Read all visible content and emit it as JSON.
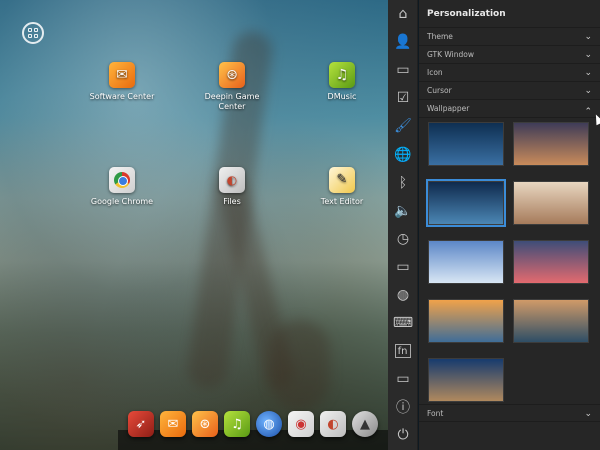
{
  "desktop": {
    "icons": [
      {
        "label": "Software Center",
        "glyph": "✉"
      },
      {
        "label": "Deepin Game Center",
        "glyph": "⊛"
      },
      {
        "label": "DMusic",
        "glyph": "♫"
      },
      {
        "label": "Google Chrome",
        "glyph": ""
      },
      {
        "label": "Files",
        "glyph": "◐"
      },
      {
        "label": "Text Editor",
        "glyph": "✎"
      }
    ]
  },
  "dock": {
    "items": [
      {
        "name": "rocket-launcher",
        "glyph": "➶"
      },
      {
        "name": "software-center",
        "glyph": "✉"
      },
      {
        "name": "game-center",
        "glyph": "⊛"
      },
      {
        "name": "dmusic",
        "glyph": "♫"
      },
      {
        "name": "browser",
        "glyph": "◍"
      },
      {
        "name": "chrome",
        "glyph": "◉"
      },
      {
        "name": "files",
        "glyph": "◐"
      },
      {
        "name": "settings",
        "glyph": "▲"
      },
      {
        "name": "more",
        "glyph": "⚙"
      }
    ]
  },
  "sidebar": {
    "items": [
      {
        "icon": "home-icon",
        "glyph": "⌂"
      },
      {
        "icon": "account-icon",
        "glyph": "👤"
      },
      {
        "icon": "display-icon",
        "glyph": "▭"
      },
      {
        "icon": "default-apps-icon",
        "glyph": "☑"
      },
      {
        "icon": "personalization-icon",
        "glyph": "🖌"
      },
      {
        "icon": "network-icon",
        "glyph": "🌐"
      },
      {
        "icon": "bluetooth-icon",
        "glyph": "ᛒ"
      },
      {
        "icon": "sound-icon",
        "glyph": "🔈"
      },
      {
        "icon": "time-icon",
        "glyph": "◷"
      },
      {
        "icon": "power-icon",
        "glyph": "▭"
      },
      {
        "icon": "mouse-icon",
        "glyph": "◍"
      },
      {
        "icon": "keyboard-icon",
        "glyph": "⌨"
      },
      {
        "icon": "font-icon",
        "glyph": "fn"
      },
      {
        "icon": "system-info-icon",
        "glyph": "▭"
      },
      {
        "icon": "info-icon",
        "glyph": "ⓘ"
      },
      {
        "icon": "shutdown-icon",
        "glyph": "⏻"
      }
    ]
  },
  "panel": {
    "title": "Personalization",
    "sections": {
      "theme": "Theme",
      "gtk": "GTK Window",
      "icon": "Icon",
      "cursor": "Cursor",
      "wallpaper": "Wallpapper",
      "font": "Font"
    },
    "chevron_down": "⌄",
    "chevron_up": "⌃"
  },
  "wallpapers": [
    {
      "name": "starry-blue",
      "selected": false,
      "c1": "#0e2f52",
      "c2": "#3a6fa2"
    },
    {
      "name": "sunset-hills",
      "selected": false,
      "c1": "#3f3c58",
      "c2": "#c98b5a"
    },
    {
      "name": "tree-night",
      "selected": true,
      "c1": "#0f2a4d",
      "c2": "#4b86b4"
    },
    {
      "name": "room-interior",
      "selected": false,
      "c1": "#e8d6c0",
      "c2": "#a67b5b"
    },
    {
      "name": "wind-turbines",
      "selected": false,
      "c1": "#5c87c7",
      "c2": "#d8e6f4"
    },
    {
      "name": "pink-sky-tree",
      "selected": false,
      "c1": "#3e4d78",
      "c2": "#e36a6f"
    },
    {
      "name": "golden-sea",
      "selected": false,
      "c1": "#f0a24a",
      "c2": "#3f6d98"
    },
    {
      "name": "rocky-coast",
      "selected": false,
      "c1": "#d09a68",
      "c2": "#2e4e66"
    },
    {
      "name": "rock-formation",
      "selected": false,
      "c1": "#173b6e",
      "c2": "#b0895e"
    }
  ]
}
